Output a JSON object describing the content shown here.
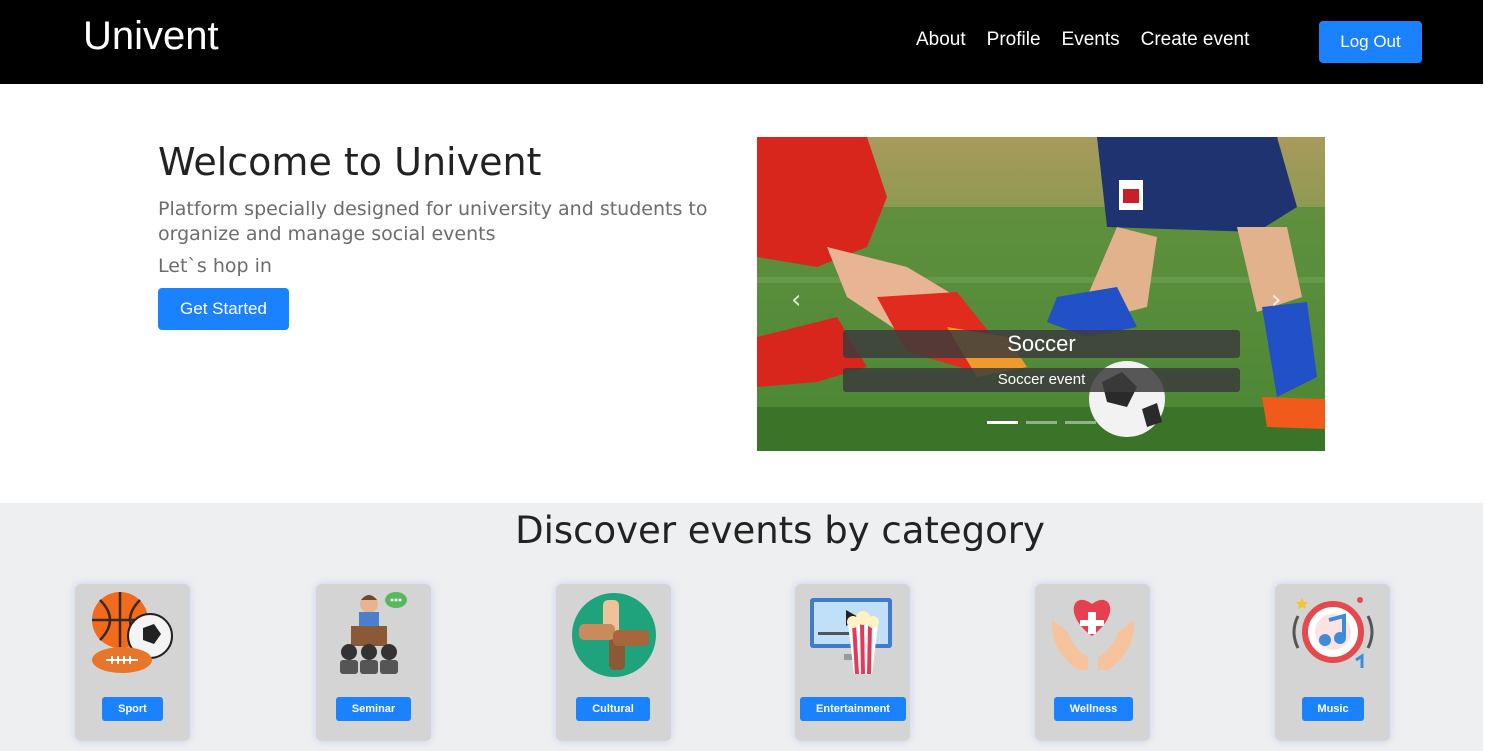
{
  "navbar": {
    "brand": "Univent",
    "links": [
      "About",
      "Profile",
      "Events",
      "Create event"
    ],
    "logout_label": "Log Out"
  },
  "hero": {
    "title": "Welcome to Univent",
    "subtitle": "Platform specially designed for university and students to organize and manage social events",
    "hop": "Let`s hop in",
    "cta_label": "Get Started"
  },
  "carousel": {
    "caption_title": "Soccer",
    "caption_text": "Soccer event",
    "prev_icon": "chevron-left-icon",
    "next_icon": "chevron-right-icon",
    "slide_count": 3,
    "active_slide": 1
  },
  "categories": {
    "title": "Discover events by category",
    "items": [
      {
        "label": "Sport",
        "icon": "sport-balls-icon"
      },
      {
        "label": "Seminar",
        "icon": "seminar-speaker-icon"
      },
      {
        "label": "Cultural",
        "icon": "cultural-hands-icon"
      },
      {
        "label": "Entertainment",
        "icon": "movie-popcorn-icon"
      },
      {
        "label": "Wellness",
        "icon": "heart-hands-icon"
      },
      {
        "label": "Music",
        "icon": "music-note-icon"
      }
    ]
  },
  "colors": {
    "navbar_bg": "#000000",
    "accent": "#1a82ff",
    "category_bg": "#eeeff0",
    "card_bg": "#d4d4d4"
  }
}
